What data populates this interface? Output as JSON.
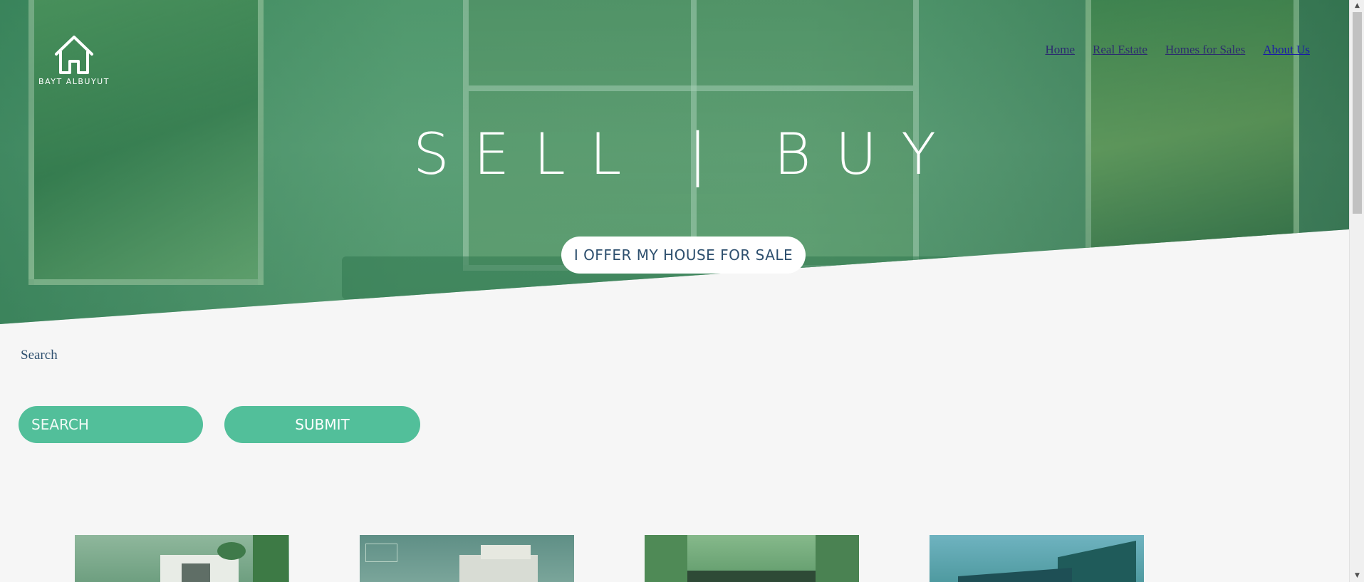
{
  "logo": {
    "text": "BAYT ALBUYUT",
    "icon": "house-icon"
  },
  "nav": {
    "items": [
      "Home",
      "Real Estate",
      "Homes for Sales",
      "About Us"
    ]
  },
  "hero": {
    "title": "SELL | BUY",
    "cta_label": "I OFFER MY HOUSE FOR SALE"
  },
  "search": {
    "label": "Search",
    "placeholder": "SEARCH",
    "value": "",
    "submit_label": "SUBMIT"
  },
  "colors": {
    "accent": "#52bf9a",
    "text_dark": "#2d4f6e",
    "background": "#f6f6f6"
  },
  "cards": [
    {
      "image": "modern-house-photo"
    },
    {
      "image": "apartment-building-photo"
    },
    {
      "image": "wooden-house-photo"
    },
    {
      "image": "angular-villa-photo"
    }
  ]
}
